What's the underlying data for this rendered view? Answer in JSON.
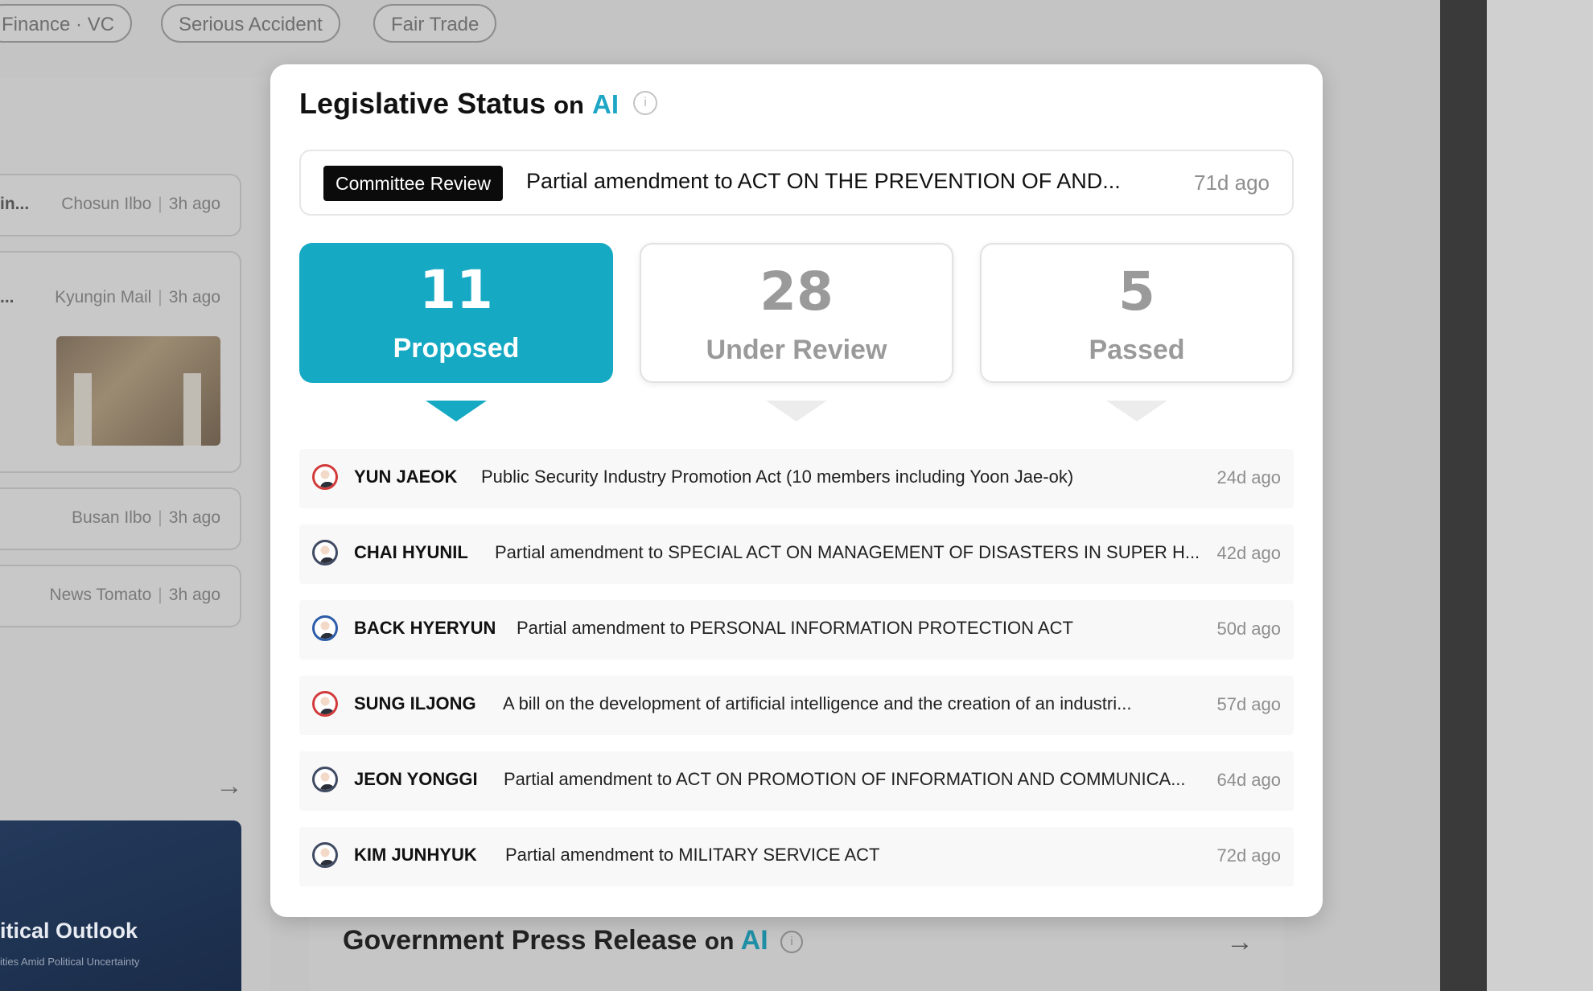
{
  "background": {
    "tags": [
      "Finance · VC",
      "Serious Accident",
      "Fair Trade"
    ],
    "news": [
      {
        "trunc": "in...",
        "source": "Chosun Ilbo",
        "time": "3h ago"
      },
      {
        "trunc": "...",
        "source": "Kyungin Mail",
        "time": "3h ago"
      },
      {
        "trunc": "",
        "source": "Busan Ilbo",
        "time": "3h ago"
      },
      {
        "trunc": "",
        "source": "News Tomato",
        "time": "3h ago"
      }
    ],
    "promo_title": "itical Outlook",
    "promo_sub": "ities Amid Political Uncertainty",
    "gov": {
      "title": "Government Press Release",
      "on": "on",
      "ai": "AI"
    }
  },
  "modal": {
    "title": "Legislative Status",
    "on": "on",
    "ai": "AI",
    "latest": {
      "badge": "Committee Review",
      "text": "Partial amendment to ACT ON THE PREVENTION OF AND...",
      "time": "71d ago"
    },
    "stats": [
      {
        "count": "11",
        "label": "Proposed",
        "active": true
      },
      {
        "count": "28",
        "label": "Under Review",
        "active": false
      },
      {
        "count": "5",
        "label": "Passed",
        "active": false
      }
    ],
    "bills": [
      {
        "name": "YUN JAEOK",
        "bill": "Public Security Industry Promotion Act (10 members including Yoon Jae-ok)",
        "time": "24d ago",
        "party": "red"
      },
      {
        "name": "CHAI HYUNIL",
        "bill": "Partial amendment to SPECIAL ACT ON MANAGEMENT OF DISASTERS IN SUPER H...",
        "time": "42d ago",
        "party": "navy"
      },
      {
        "name": "BACK HYERYUN",
        "bill": "Partial amendment to PERSONAL INFORMATION PROTECTION ACT",
        "time": "50d ago",
        "party": "blue"
      },
      {
        "name": "SUNG ILJONG",
        "bill": "A bill on the development of artificial intelligence and the creation of an industri...",
        "time": "57d ago",
        "party": "red"
      },
      {
        "name": "JEON YONGGI",
        "bill": "Partial amendment to ACT ON PROMOTION OF INFORMATION AND COMMUNICA...",
        "time": "64d ago",
        "party": "navy"
      },
      {
        "name": "KIM JUNHYUK",
        "bill": "Partial amendment to MILITARY SERVICE ACT",
        "time": "72d ago",
        "party": "navy"
      }
    ]
  },
  "colors": {
    "accent": "#15a9c3",
    "ai": "#1ea6c6"
  }
}
